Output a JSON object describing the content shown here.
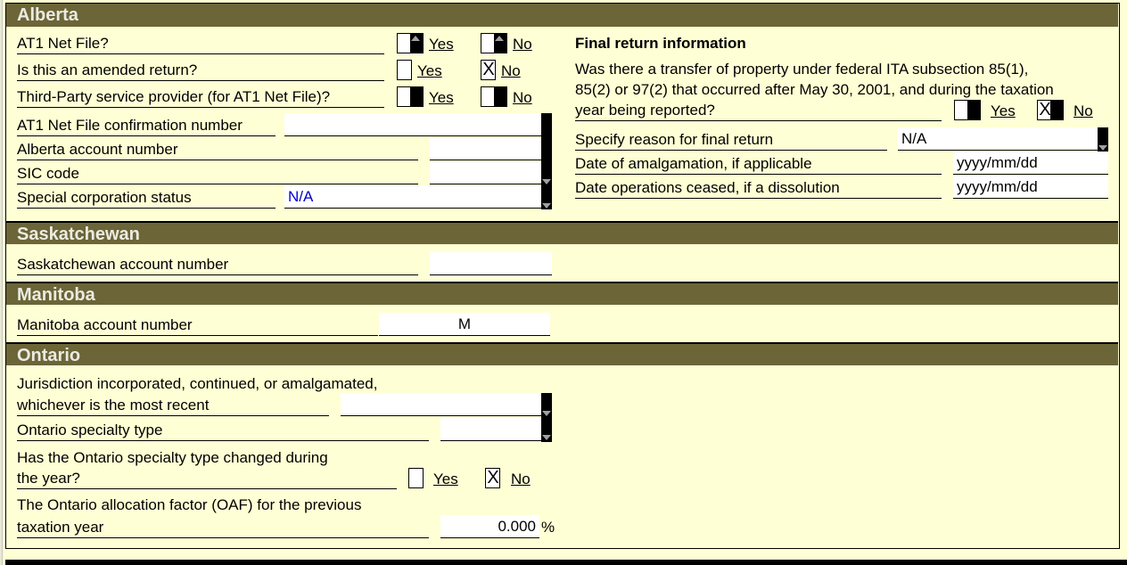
{
  "sections": {
    "alberta": "Alberta",
    "saskatchewan": "Saskatchewan",
    "manitoba": "Manitoba",
    "ontario": "Ontario"
  },
  "alberta": {
    "at1_net_file": {
      "label": "AT1 Net File?",
      "yes": "Yes",
      "no": "No",
      "yes_checked": false,
      "no_checked": false
    },
    "amended": {
      "label": "Is this an amended return?",
      "yes": "Yes",
      "no": "No",
      "no_mark": "X"
    },
    "third_party": {
      "label": "Third-Party service provider (for AT1 Net File)?",
      "yes": "Yes",
      "no": "No"
    },
    "confirmation_number": {
      "label": "AT1 Net File confirmation number",
      "value": ""
    },
    "account_number": {
      "label": "Alberta account number",
      "value": ""
    },
    "sic_code": {
      "label": "SIC code",
      "value": ""
    },
    "special_status": {
      "label": "Special corporation status",
      "value": "N/A"
    }
  },
  "final_return": {
    "heading": "Final return information",
    "transfer_question_line1": "Was there a transfer of property under federal ITA subsection 85(1),",
    "transfer_question_line2": "85(2) or 97(2) that occurred after May 30, 2001, and during the taxation",
    "transfer_question_line3": "year being reported?",
    "yes": "Yes",
    "no": "No",
    "no_mark": "X",
    "reason": {
      "label": "Specify reason for final return",
      "value": "N/A"
    },
    "amalgamation_date": {
      "label": "Date of amalgamation, if applicable",
      "placeholder": "yyyy/mm/dd"
    },
    "ceased_date": {
      "label": "Date operations ceased, if a dissolution",
      "placeholder": "yyyy/mm/dd"
    }
  },
  "saskatchewan": {
    "account_number": {
      "label": "Saskatchewan account number",
      "value": ""
    }
  },
  "manitoba": {
    "account_number": {
      "label": "Manitoba account number",
      "value": "M"
    }
  },
  "ontario": {
    "jurisdiction": {
      "label_line1": "Jurisdiction incorporated, continued, or amalgamated,",
      "label_line2": "whichever is the most recent",
      "value": ""
    },
    "specialty_type": {
      "label": "Ontario specialty type",
      "value": ""
    },
    "specialty_changed": {
      "label_line1": "Has the Ontario specialty type changed during",
      "label_line2": "the year?",
      "yes": "Yes",
      "no": "No",
      "no_mark": "X"
    },
    "oaf": {
      "label_line1": "The Ontario allocation factor (OAF) for the previous",
      "label_line2": "taxation year",
      "value": "0.000",
      "unit": "%"
    }
  }
}
